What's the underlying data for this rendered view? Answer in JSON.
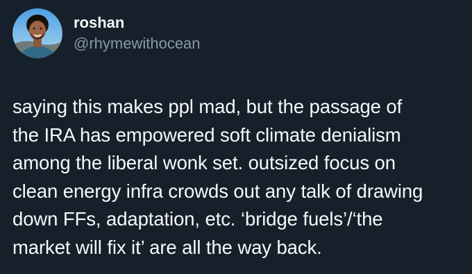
{
  "author": {
    "display_name": "roshan",
    "handle": "@rhymewithocean",
    "avatar_icon": "profile-photo"
  },
  "tweet": {
    "lines": [
      "saying this makes ppl mad, but the passage of",
      "the IRA has empowered soft climate denialism",
      "among the liberal wonk set. outsized focus on",
      "clean energy infra crowds out any talk of drawing",
      "down FFs, adaptation, etc. ‘bridge fuels’/‘the",
      "market will fix it’ are all the way back."
    ]
  },
  "colors": {
    "background": "#15202b",
    "primary_text": "#f7f9f9",
    "secondary_text": "#8b98a5"
  }
}
